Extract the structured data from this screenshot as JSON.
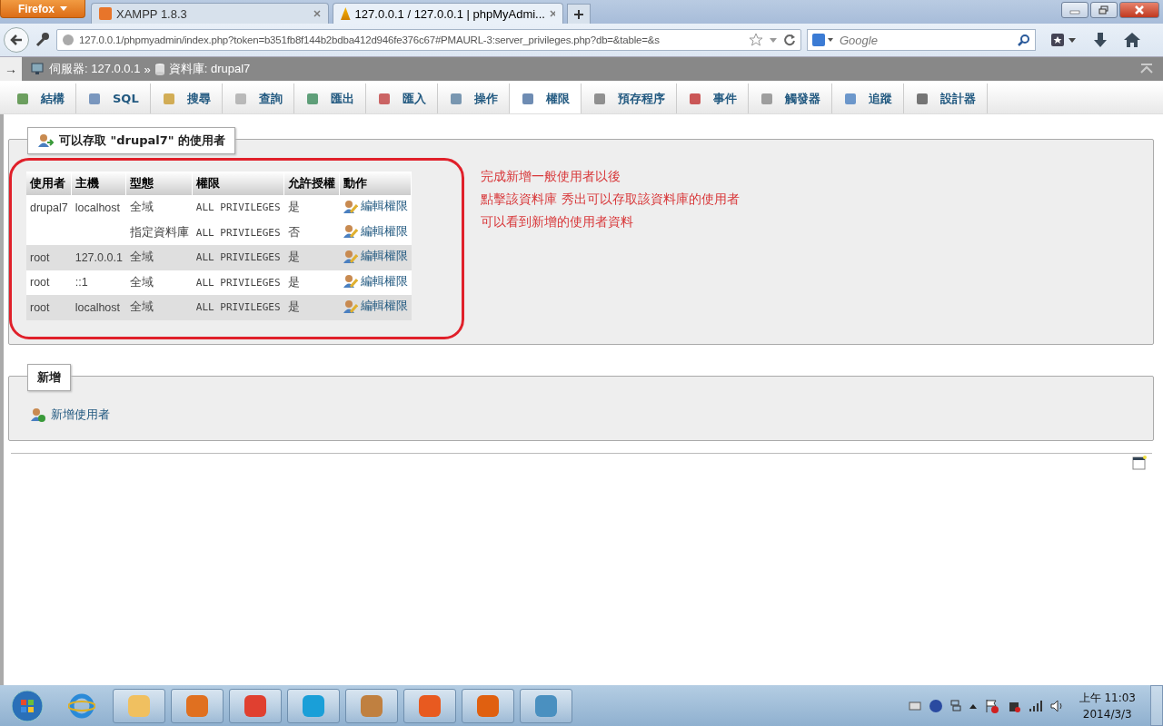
{
  "browser": {
    "menu_button": "Firefox",
    "tabs": [
      {
        "title": "XAMPP 1.8.3",
        "selected": false
      },
      {
        "title": "127.0.0.1 / 127.0.0.1 | phpMyAdmi...",
        "selected": true
      }
    ],
    "url": "127.0.0.1/phpmyadmin/index.php?token=b351fb8f144b2bdba412d946fe376c67#PMAURL-3:server_privileges.php?db=&table=&s",
    "search": {
      "placeholder": "Google"
    }
  },
  "breadcrumb": {
    "toggle": "→",
    "server": "伺服器: 127.0.0.1",
    "separator": "»",
    "database": "資料庫: drupal7"
  },
  "menu_tabs": [
    {
      "label": "結構",
      "selected": false
    },
    {
      "label": "SQL",
      "selected": false
    },
    {
      "label": "搜尋",
      "selected": false
    },
    {
      "label": "查詢",
      "selected": false
    },
    {
      "label": "匯出",
      "selected": false
    },
    {
      "label": "匯入",
      "selected": false
    },
    {
      "label": "操作",
      "selected": false
    },
    {
      "label": "權限",
      "selected": true
    },
    {
      "label": "預存程序",
      "selected": false
    },
    {
      "label": "事件",
      "selected": false
    },
    {
      "label": "觸發器",
      "selected": false
    },
    {
      "label": "追蹤",
      "selected": false
    },
    {
      "label": "設計器",
      "selected": false
    }
  ],
  "users_panel": {
    "legend": "可以存取 \"drupal7\" 的使用者",
    "columns": [
      "使用者",
      "主機",
      "型態",
      "權限",
      "允許授權",
      "動作"
    ],
    "groups": [
      {
        "user": "drupal7",
        "host": "localhost",
        "grants": [
          {
            "type": "全域",
            "privileges": "ALL PRIVILEGES",
            "grant": "是",
            "action": "編輯權限"
          },
          {
            "type": "指定資料庫",
            "privileges": "ALL PRIVILEGES",
            "grant": "否",
            "action": "編輯權限"
          }
        ]
      },
      {
        "user": "root",
        "host": "127.0.0.1",
        "grants": [
          {
            "type": "全域",
            "privileges": "ALL PRIVILEGES",
            "grant": "是",
            "action": "編輯權限"
          }
        ]
      },
      {
        "user": "root",
        "host": "::1",
        "grants": [
          {
            "type": "全域",
            "privileges": "ALL PRIVILEGES",
            "grant": "是",
            "action": "編輯權限"
          }
        ]
      },
      {
        "user": "root",
        "host": "localhost",
        "grants": [
          {
            "type": "全域",
            "privileges": "ALL PRIVILEGES",
            "grant": "是",
            "action": "編輯權限"
          }
        ]
      }
    ],
    "notes": [
      "完成新增一般使用者以後",
      "點擊該資料庫 秀出可以存取該資料庫的使用者",
      "可以看到新增的使用者資料"
    ]
  },
  "new_panel": {
    "legend": "新增",
    "link": "新增使用者"
  },
  "taskbar": {
    "time": "上午 11:03",
    "date": "2014/3/3"
  }
}
